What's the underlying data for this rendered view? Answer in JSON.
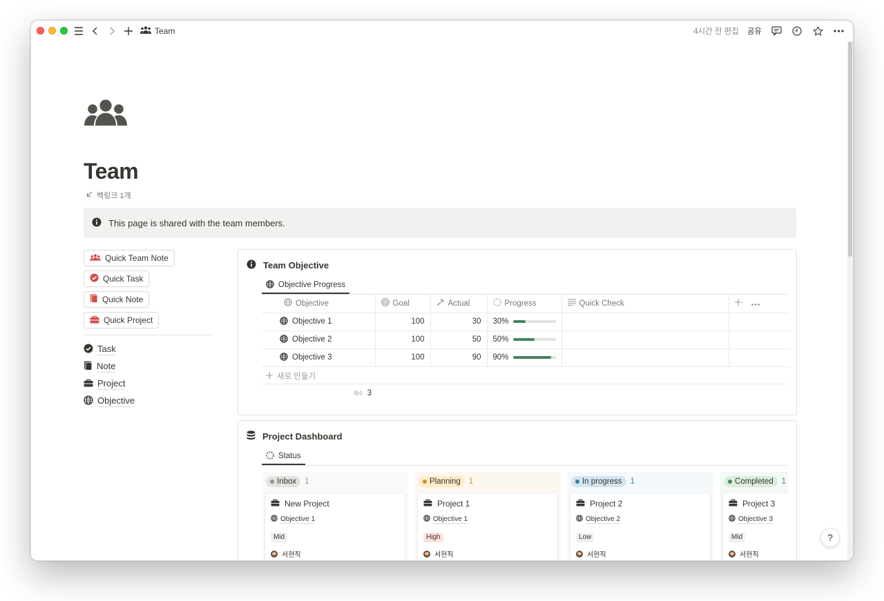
{
  "topbar": {
    "breadcrumb_title": "Team",
    "edited": "4시간 전 편집",
    "share": "공유"
  },
  "page": {
    "title": "Team",
    "backlinks": "백링크 1개",
    "callout": "This page is shared with the team members."
  },
  "quick_buttons": [
    {
      "label": "Quick Team Note",
      "icon": "team-icon",
      "color": "#d44c47"
    },
    {
      "label": "Quick Task",
      "icon": "check-circle-icon",
      "color": "#d44c47"
    },
    {
      "label": "Quick Note",
      "icon": "note-icon",
      "color": "#d44c47"
    },
    {
      "label": "Quick Project",
      "icon": "briefcase-icon",
      "color": "#d44c47"
    }
  ],
  "nav_links": [
    {
      "label": "Task",
      "icon": "check-circle-icon"
    },
    {
      "label": "Note",
      "icon": "note-icon"
    },
    {
      "label": "Project",
      "icon": "briefcase-icon"
    },
    {
      "label": "Objective",
      "icon": "globe-icon"
    }
  ],
  "objective": {
    "title": "Team Objective",
    "view_tab": "Objective Progress",
    "columns": {
      "objective": "Objective",
      "goal": "Goal",
      "actual": "Actual",
      "progress": "Progress",
      "quick_check": "Quick Check"
    },
    "rows": [
      {
        "name": "Objective 1",
        "goal": "100",
        "actual": "30",
        "progress": "30%",
        "fraction": 0.3
      },
      {
        "name": "Objective 2",
        "goal": "100",
        "actual": "50",
        "progress": "50%",
        "fraction": 0.5
      },
      {
        "name": "Objective 3",
        "goal": "100",
        "actual": "90",
        "progress": "90%",
        "fraction": 0.9
      }
    ],
    "new_row": "새로 만들기",
    "count_label": "개수",
    "count_value": "3",
    "progress_color": "#448361"
  },
  "dashboard": {
    "title": "Project Dashboard",
    "view_tab": "Status",
    "columns": [
      {
        "status": "Inbox",
        "count": "1",
        "bg": "#f9f9f8",
        "tag_bg": "#e3e2e0",
        "dot": "#91918e",
        "count_color": "#9b9a97",
        "card": {
          "title": "New Project",
          "objective": "Objective 1",
          "priority": "Mid",
          "prio_bg": "#f1f1ef",
          "user": "서현직"
        }
      },
      {
        "status": "Planning",
        "count": "1",
        "bg": "#fcf8f0",
        "tag_bg": "#fdecc8",
        "dot": "#cb912f",
        "count_color": "#cb912f",
        "card": {
          "title": "Project 1",
          "objective": "Objective 1",
          "priority": "High",
          "prio_bg": "#ffe2dd",
          "user": "서현직"
        }
      },
      {
        "status": "In progress",
        "count": "1",
        "bg": "#f5f9fc",
        "tag_bg": "#d3e5ef",
        "dot": "#337ea9",
        "count_color": "#337ea9",
        "card": {
          "title": "Project 2",
          "objective": "Objective 2",
          "priority": "Low",
          "prio_bg": "#f1f1ef",
          "user": "서현직"
        }
      },
      {
        "status": "Completed",
        "count": "1",
        "bg": "#f4f9f6",
        "tag_bg": "#dbeddb",
        "dot": "#448361",
        "count_color": "#448361",
        "card": {
          "title": "Project 3",
          "objective": "Objective 3",
          "priority": "Mid",
          "prio_bg": "#f1f1ef",
          "user": "서현직"
        }
      }
    ]
  },
  "help": "?"
}
